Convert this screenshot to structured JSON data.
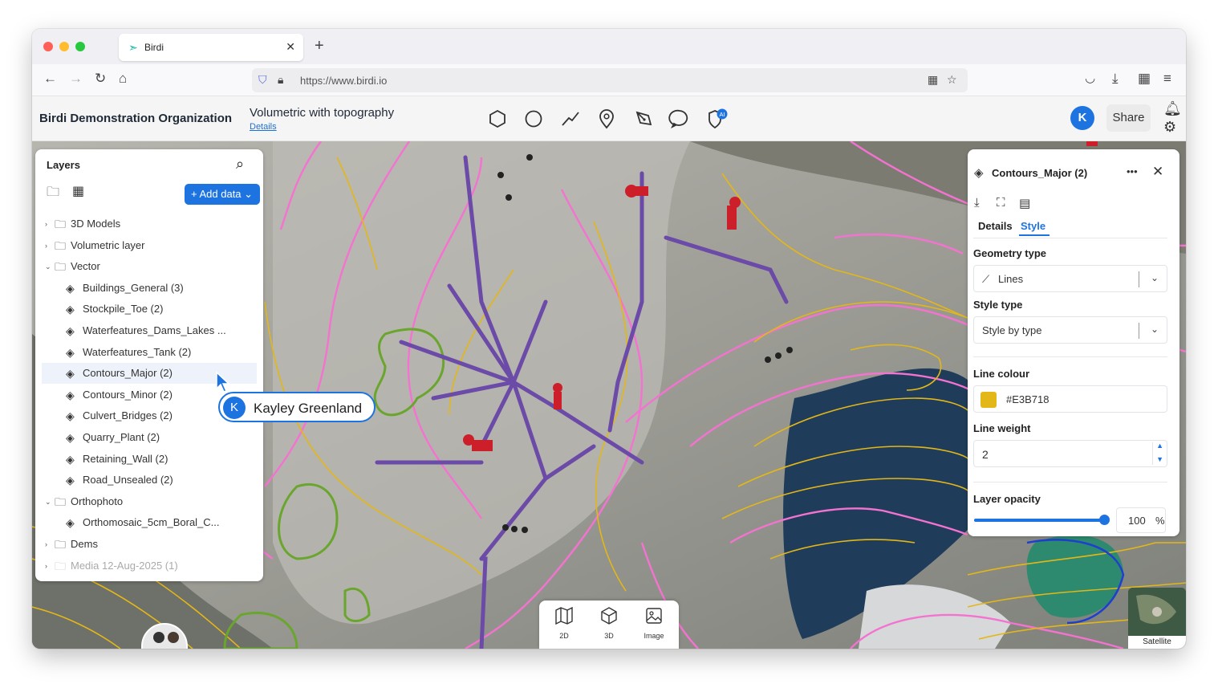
{
  "browser": {
    "tab_title": "Birdi",
    "tab_close": "✕",
    "new_tab": "+",
    "url": "https://www.birdi.io"
  },
  "header": {
    "org_name": "Birdi Demonstration Organization",
    "project_title": "Volumetric with topography",
    "details_link": "Details",
    "user_initial": "K",
    "share_label": "Share",
    "ai_badge": "AI"
  },
  "layers": {
    "title": "Layers",
    "add_data_label": "+ Add data",
    "items": [
      {
        "label": "3D Models",
        "type": "folder",
        "expanded": false
      },
      {
        "label": "Volumetric layer",
        "type": "folder",
        "expanded": false
      },
      {
        "label": "Vector",
        "type": "folder",
        "expanded": true
      },
      {
        "label": "Buildings_General (3)",
        "type": "layer"
      },
      {
        "label": "Stockpile_Toe (2)",
        "type": "layer"
      },
      {
        "label": "Waterfeatures_Dams_Lakes ...",
        "type": "layer"
      },
      {
        "label": "Waterfeatures_Tank (2)",
        "type": "layer"
      },
      {
        "label": "Contours_Major (2)",
        "type": "layer",
        "selected": true
      },
      {
        "label": "Contours_Minor (2)",
        "type": "layer"
      },
      {
        "label": "Culvert_Bridges (2)",
        "type": "layer"
      },
      {
        "label": "Quarry_Plant (2)",
        "type": "layer"
      },
      {
        "label": "Retaining_Wall (2)",
        "type": "layer"
      },
      {
        "label": "Road_Unsealed (2)",
        "type": "layer"
      },
      {
        "label": "Orthophoto",
        "type": "folder",
        "expanded": true
      },
      {
        "label": "Orthomosaic_5cm_Boral_C...",
        "type": "layer"
      },
      {
        "label": "Dems",
        "type": "folder",
        "expanded": false
      },
      {
        "label": "Media 12-Aug-2025 (1)",
        "type": "folder",
        "expanded": false,
        "muted": true
      }
    ]
  },
  "collaborator": {
    "initial": "K",
    "name": "Kayley Greenland"
  },
  "style_panel": {
    "title": "Contours_Major (2)",
    "more": "•••",
    "close": "✕",
    "tabs": {
      "details": "Details",
      "style": "Style"
    },
    "geometry_type_label": "Geometry type",
    "geometry_type_value": "Lines",
    "style_type_label": "Style type",
    "style_type_value": "Style by type",
    "line_colour_label": "Line colour",
    "line_colour_value": "#E3B718",
    "line_weight_label": "Line weight",
    "line_weight_value": "2",
    "layer_opacity_label": "Layer opacity",
    "layer_opacity_value": "100",
    "layer_opacity_unit": "%",
    "layer_opacity_fraction": 1.0
  },
  "view_switcher": {
    "view_2d": "2D",
    "view_3d": "3D",
    "image": "Image"
  },
  "basemap": {
    "label": "Satellite"
  },
  "colors": {
    "accent": "#1d74e0",
    "contour_major": "#E3B718",
    "contour_pink": "#f472d0",
    "structure_purple": "#6b4aa8"
  }
}
